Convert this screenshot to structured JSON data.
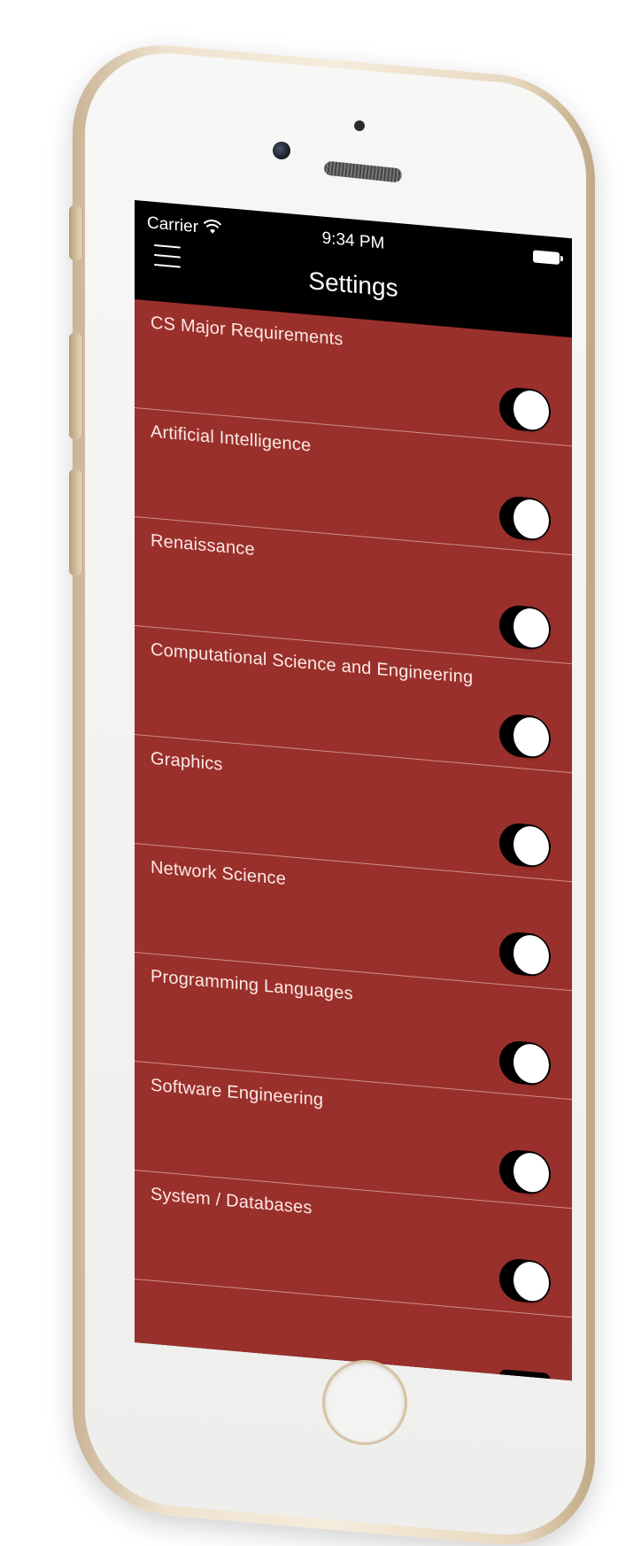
{
  "status_bar": {
    "carrier": "Carrier",
    "time": "9:34 PM",
    "wifi_icon": "wifi-icon",
    "battery_icon": "battery-icon"
  },
  "nav": {
    "title": "Settings",
    "menu_icon": "hamburger-menu-icon"
  },
  "colors": {
    "list_background": "#9a302b",
    "nav_background": "#000000",
    "toggle_track": "#000000",
    "toggle_knob": "#ffffff"
  },
  "settings": [
    {
      "label": "CS Major Requirements",
      "enabled": true
    },
    {
      "label": "Artificial Intelligence",
      "enabled": true
    },
    {
      "label": "Renaissance",
      "enabled": true
    },
    {
      "label": "Computational Science and Engineering",
      "enabled": true
    },
    {
      "label": "Graphics",
      "enabled": true
    },
    {
      "label": "Network Science",
      "enabled": true
    },
    {
      "label": "Programming Languages",
      "enabled": true
    },
    {
      "label": "Software Engineering",
      "enabled": true
    },
    {
      "label": "System / Databases",
      "enabled": true
    }
  ]
}
